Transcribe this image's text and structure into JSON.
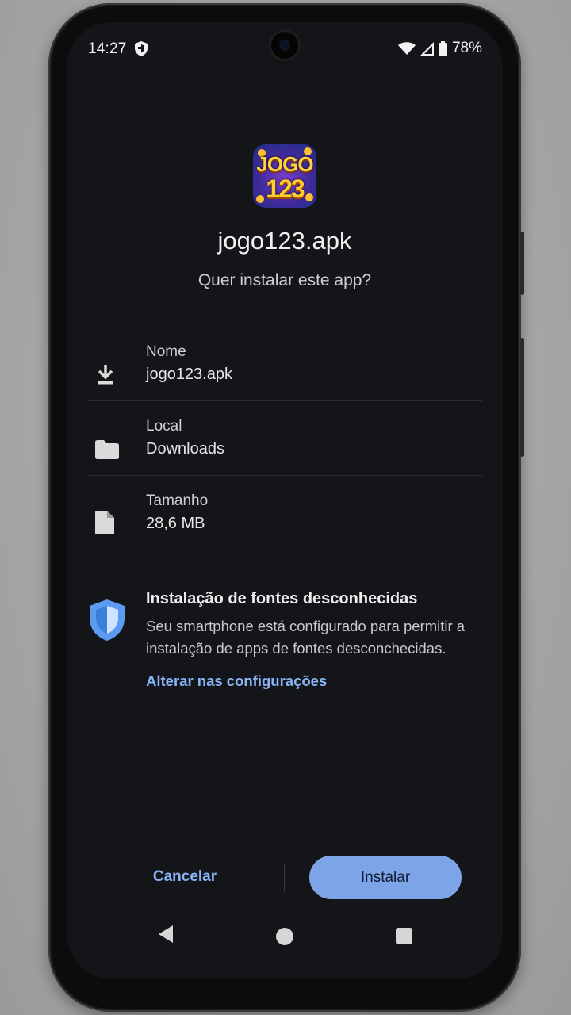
{
  "status_bar": {
    "time": "14:27",
    "battery": "78%",
    "icons": [
      "shield-icon",
      "wifi-icon",
      "signal-icon",
      "battery-icon"
    ]
  },
  "app": {
    "icon_line1": "JOGO",
    "icon_line2": "123",
    "file_name": "jogo123.apk",
    "question": "Quer instalar este app?"
  },
  "details": [
    {
      "label": "Nome",
      "value": "jogo123.apk",
      "icon": "download-icon"
    },
    {
      "label": "Local",
      "value": "Downloads",
      "icon": "folder-icon"
    },
    {
      "label": "Tamanho",
      "value": "28,6 MB",
      "icon": "file-icon"
    }
  ],
  "warning": {
    "title": "Instalação de fontes desconhecidas",
    "text": "Seu smartphone está configurado para permitir a instalação de apps de fontes desconchecidas.",
    "link": "Alterar nas configurações",
    "icon": "shield-icon"
  },
  "actions": {
    "cancel": "Cancelar",
    "install": "Instalar"
  },
  "colors": {
    "background": "#131518",
    "accent": "#8ab4f8",
    "install_button": "#7ea4e8"
  }
}
